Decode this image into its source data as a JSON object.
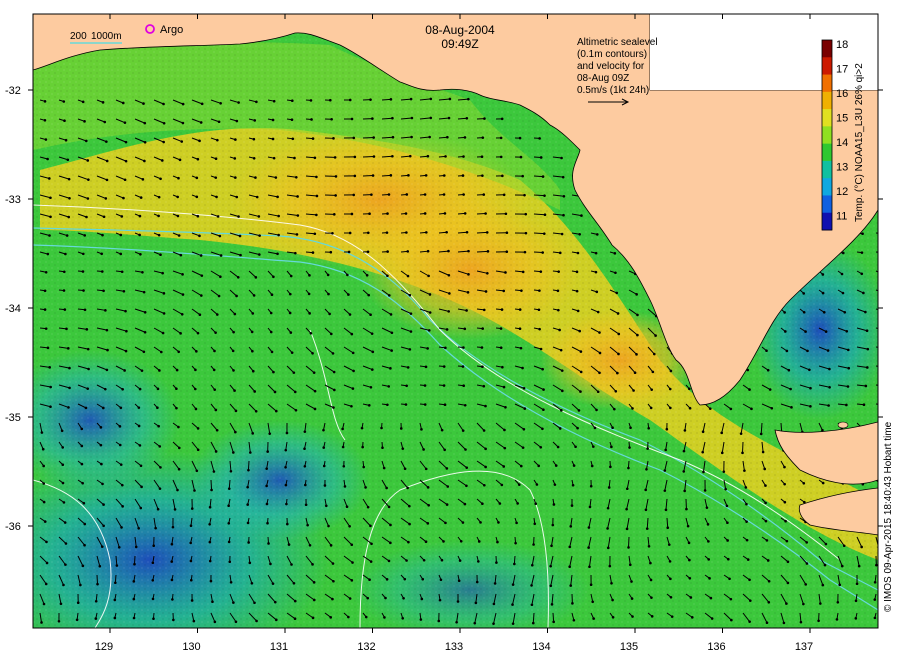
{
  "header": {
    "date": "08-Aug-2004",
    "time": "09:49Z"
  },
  "legend_isobaths": {
    "label_200": "200",
    "label_1000": "1000m",
    "line_color": "#66d9d9"
  },
  "legend_argo": {
    "label": "Argo",
    "marker_color": "#e000e0"
  },
  "sealevel_note": {
    "lines": [
      "Altimetric sealevel",
      "(0.1m contours)",
      "and velocity for",
      "08-Aug 09Z",
      "0.5m/s (1kt 24h)"
    ]
  },
  "colorbar": {
    "title": "Temp. (°C) NOAA15_L3U 26% qi>2",
    "ticks": [
      "18",
      "17",
      "16",
      "15",
      "14",
      "13",
      "12",
      "11"
    ],
    "colors": [
      "#7a0000",
      "#cc1a00",
      "#f07000",
      "#f0b000",
      "#e0e020",
      "#90e020",
      "#30c830",
      "#10c0a0",
      "#10a8e0",
      "#1060e0",
      "#1010b0"
    ]
  },
  "credit": "© IMOS 09-Apr-2015 18:40:43 Hobart time",
  "axes": {
    "x_ticks": [
      "129",
      "130",
      "131",
      "132",
      "133",
      "134",
      "135",
      "136",
      "137"
    ],
    "y_ticks": [
      "-32",
      "-33",
      "-34",
      "-35",
      "-36"
    ]
  },
  "colors": {
    "land": "#fdcba0",
    "warm": "#f5c000",
    "mid": "#3cc83c",
    "cool": "#10b0c0",
    "cold": "#1a4ad0"
  }
}
